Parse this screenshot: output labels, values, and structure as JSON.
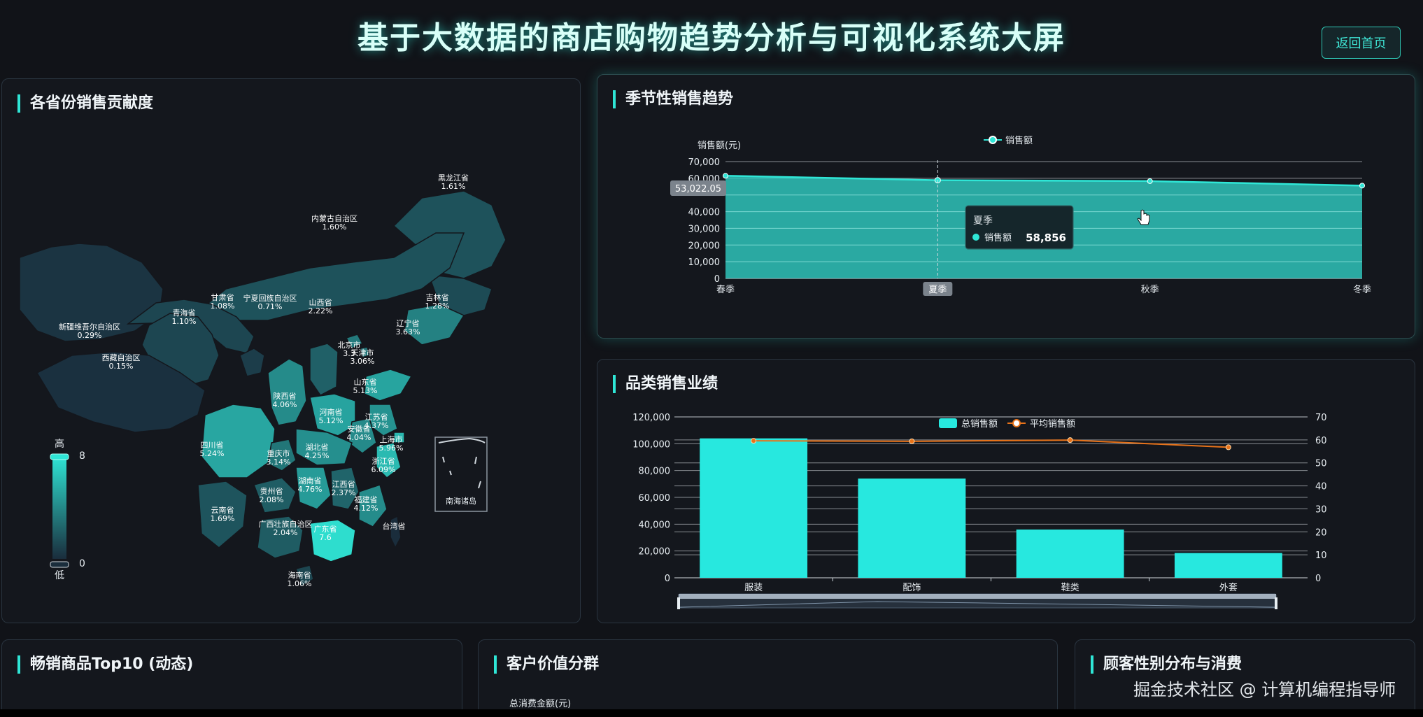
{
  "header": {
    "title": "基于大数据的商店购物趋势分析与可视化系统大屏",
    "back_button": "返回首页"
  },
  "panels": {
    "province": {
      "title": "各省份销售贡献度",
      "legend_high": "高",
      "legend_low": "低",
      "legend_max": "8",
      "legend_min": "0",
      "inset_label": "南海诸岛"
    },
    "seasonal": {
      "title": "季节性销售趋势"
    },
    "category": {
      "title": "品类销售业绩"
    },
    "top10": {
      "title": "畅销商品Top10 (动态)"
    },
    "customer": {
      "title": "客户价值分群",
      "axis_label": "总消费金额(元)"
    },
    "gender": {
      "title": "顾客性别分布与消费"
    }
  },
  "map": {
    "provinces": [
      {
        "name": "黑龙江省",
        "value": "1.61%"
      },
      {
        "name": "吉林省",
        "value": "1.28%"
      },
      {
        "name": "辽宁省",
        "value": "3.63%"
      },
      {
        "name": "内蒙古自治区",
        "value": "1.60%"
      },
      {
        "name": "新疆维吾尔自治区",
        "value": "0.29%"
      },
      {
        "name": "甘肃省",
        "value": "1.08%"
      },
      {
        "name": "宁夏回族自治区",
        "value": "0.71%"
      },
      {
        "name": "山西省",
        "value": "2.22%"
      },
      {
        "name": "北京市",
        "value": "3.3"
      },
      {
        "name": "天津市",
        "value": "3.06%"
      },
      {
        "name": "青海省",
        "value": "1.10%"
      },
      {
        "name": "陕西省",
        "value": "4.06%"
      },
      {
        "name": "山东省",
        "value": "5.13%"
      },
      {
        "name": "河南省",
        "value": "5.12%"
      },
      {
        "name": "江苏省",
        "value": "4.37%"
      },
      {
        "name": "安徽省",
        "value": "4.04%"
      },
      {
        "name": "西藏自治区",
        "value": "0.15%"
      },
      {
        "name": "四川省",
        "value": "5.24%"
      },
      {
        "name": "湖北省",
        "value": "4.25%"
      },
      {
        "name": "上海市",
        "value": "5.96%"
      },
      {
        "name": "重庆市",
        "value": "3.14%"
      },
      {
        "name": "浙江省",
        "value": "6.09%"
      },
      {
        "name": "湖南省",
        "value": "4.76%"
      },
      {
        "name": "江西省",
        "value": "2.37%"
      },
      {
        "name": "贵州省",
        "value": "2.08%"
      },
      {
        "name": "福建省",
        "value": "4.12%"
      },
      {
        "name": "云南省",
        "value": "1.69%"
      },
      {
        "name": "广西壮族自治区",
        "value": "2.04%"
      },
      {
        "name": "广东省",
        "value": "7.6"
      },
      {
        "name": "台湾省",
        "value": ""
      },
      {
        "name": "海南省",
        "value": "1.06%"
      }
    ],
    "colors": {
      "low": "#1a2d3c",
      "high": "#2fe6d6"
    }
  },
  "chart_data": [
    {
      "type": "area",
      "categories": [
        "春季",
        "夏季",
        "秋季",
        "冬季"
      ],
      "series": [
        {
          "name": "销售额",
          "values": [
            61500,
            58856,
            58300,
            55600
          ]
        }
      ],
      "ylabel": "销售额(元)",
      "ylim": [
        0,
        70000
      ],
      "yticks": [
        "0",
        "10,000",
        "20,000",
        "30,000",
        "40,000",
        "60,000",
        "70,000"
      ],
      "pointer_label": "53,022.05",
      "tooltip": {
        "title": "夏季",
        "series": "销售额",
        "value": "58,856"
      },
      "color": "#2fe6d6"
    },
    {
      "type": "bar",
      "categories": [
        "服装",
        "配饰",
        "鞋类",
        "外套"
      ],
      "series": [
        {
          "name": "总销售额",
          "values": [
            104000,
            74000,
            36000,
            18500
          ],
          "axis": "left"
        },
        {
          "name": "平均销售额",
          "values": [
            59.6,
            59.4,
            59.9,
            56.8
          ],
          "axis": "right"
        }
      ],
      "ylim_left": [
        0,
        120000
      ],
      "ylim_right": [
        0,
        70
      ],
      "yticks_left": [
        "0",
        "20,000",
        "40,000",
        "60,000",
        "80,000",
        "100,000",
        "120,000"
      ],
      "yticks_right": [
        "0",
        "10",
        "20",
        "30",
        "40",
        "50",
        "60",
        "70"
      ],
      "colors": {
        "bar": "#27e8df",
        "line": "#e8731a"
      }
    }
  ],
  "watermark": "掘金技术社区 @ 计算机编程指导师"
}
